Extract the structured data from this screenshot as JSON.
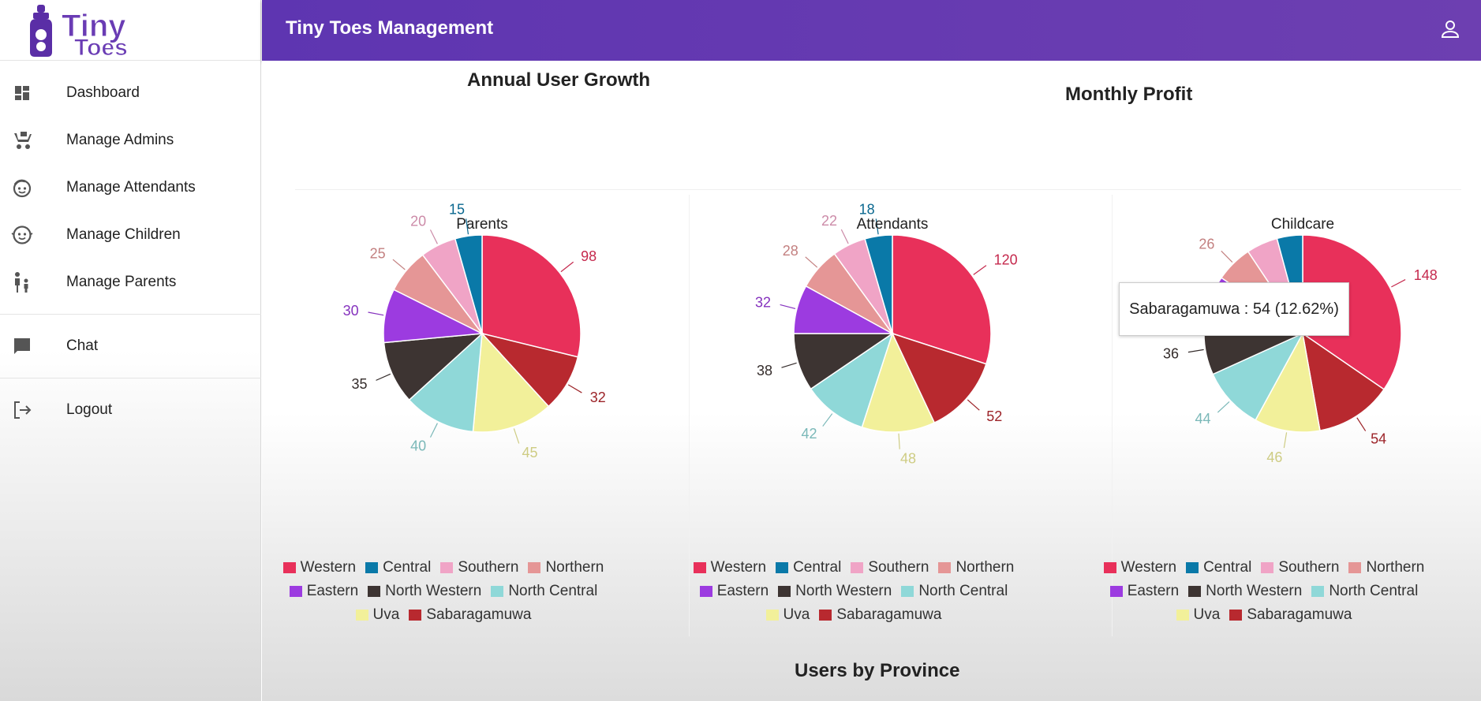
{
  "app": {
    "title": "Tiny Toes Management",
    "logo_text": "Tiny Toes"
  },
  "sidebar": {
    "items": [
      {
        "label": "Dashboard",
        "icon": "dashboard-icon"
      },
      {
        "label": "Manage Admins",
        "icon": "stroller-icon"
      },
      {
        "label": "Manage Attendants",
        "icon": "face-icon"
      },
      {
        "label": "Manage Children",
        "icon": "child-face-icon"
      },
      {
        "label": "Manage Parents",
        "icon": "family-icon"
      },
      {
        "label": "Chat",
        "icon": "chat-icon"
      },
      {
        "label": "Logout",
        "icon": "logout-icon"
      }
    ]
  },
  "sections": {
    "annual_growth": "Annual User Growth",
    "monthly_profit": "Monthly Profit",
    "users_by_province": "Users by Province"
  },
  "tooltip": {
    "text": "Sabaragamuwa : 54 (12.62%)"
  },
  "colors": {
    "Western": "#e8305a",
    "Central": "#0a79a8",
    "Southern": "#f0a4c6",
    "Northern": "#e59696",
    "Eastern": "#9c3be0",
    "North Western": "#3d3432",
    "North Central": "#8fd8d8",
    "Uva": "#f2f09a",
    "Sabaragamuwa": "#b8292f"
  },
  "chart_data": [
    {
      "type": "pie",
      "title": "Parents",
      "categories": [
        "Western",
        "Sabaragamuwa",
        "Uva",
        "North Central",
        "North Western",
        "Eastern",
        "Northern",
        "Southern",
        "Central"
      ],
      "values": [
        98,
        32,
        45,
        40,
        35,
        30,
        25,
        20,
        15
      ],
      "legend": [
        "Western",
        "Central",
        "Southern",
        "Northern",
        "Eastern",
        "North Western",
        "North Central",
        "Uva",
        "Sabaragamuwa"
      ]
    },
    {
      "type": "pie",
      "title": "Attendants",
      "categories": [
        "Western",
        "Sabaragamuwa",
        "Uva",
        "North Central",
        "North Western",
        "Eastern",
        "Northern",
        "Southern",
        "Central"
      ],
      "values": [
        120,
        52,
        48,
        42,
        38,
        32,
        28,
        22,
        18
      ],
      "legend": [
        "Western",
        "Central",
        "Southern",
        "Northern",
        "Eastern",
        "North Western",
        "North Central",
        "Uva",
        "Sabaragamuwa"
      ]
    },
    {
      "type": "pie",
      "title": "Childcare",
      "categories": [
        "Western",
        "Sabaragamuwa",
        "Uva",
        "North Central",
        "North Western",
        "Eastern",
        "Northern",
        "Southern",
        "Central"
      ],
      "values": [
        148,
        54,
        46,
        44,
        36,
        34,
        26,
        22,
        18
      ],
      "hidden_labels": [
        "Southern",
        "Central"
      ],
      "legend": [
        "Western",
        "Central",
        "Southern",
        "Northern",
        "Eastern",
        "North Western",
        "North Central",
        "Uva",
        "Sabaragamuwa"
      ]
    }
  ]
}
